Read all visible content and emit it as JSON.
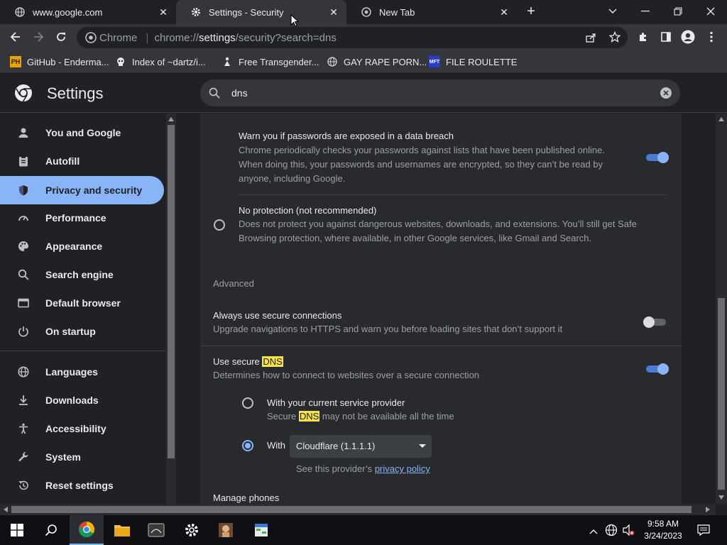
{
  "browser": {
    "tabs": [
      {
        "title": "www.google.com",
        "active": false,
        "icon": "globe-icon"
      },
      {
        "title": "Settings - Security",
        "active": true,
        "icon": "gear-icon"
      },
      {
        "title": "New Tab",
        "active": false,
        "icon": "chrome-icon"
      }
    ],
    "omnibox": {
      "site_chip": "Chrome",
      "url_prefix": "chrome://",
      "url_host": "settings",
      "url_rest": "/security?search=dns"
    },
    "bookmarks": [
      {
        "label": "GitHub - Enderma...",
        "icon": "PH"
      },
      {
        "label": "Index of ~dartz/i...",
        "icon": "skull-icon"
      },
      {
        "label": "Free Transgender...",
        "icon": "figure-icon"
      },
      {
        "label": "GAY RAPE PORN...",
        "icon": "globe-icon"
      },
      {
        "label": "FILE ROULETTE",
        "icon": "MFT"
      }
    ]
  },
  "settings": {
    "title": "Settings",
    "search_value": "dns",
    "nav": [
      {
        "label": "You and Google",
        "icon": "person-icon",
        "selected": false
      },
      {
        "label": "Autofill",
        "icon": "clipboard-icon",
        "selected": false
      },
      {
        "label": "Privacy and security",
        "icon": "shield-icon",
        "selected": true
      },
      {
        "label": "Performance",
        "icon": "speedometer-icon",
        "selected": false
      },
      {
        "label": "Appearance",
        "icon": "palette-icon",
        "selected": false
      },
      {
        "label": "Search engine",
        "icon": "search-icon",
        "selected": false
      },
      {
        "label": "Default browser",
        "icon": "browser-icon",
        "selected": false
      },
      {
        "label": "On startup",
        "icon": "power-icon",
        "selected": false
      },
      {
        "label": "Languages",
        "icon": "globe-icon",
        "selected": false
      },
      {
        "label": "Downloads",
        "icon": "download-icon",
        "selected": false
      },
      {
        "label": "Accessibility",
        "icon": "accessibility-icon",
        "selected": false
      },
      {
        "label": "System",
        "icon": "wrench-icon",
        "selected": false
      },
      {
        "label": "Reset settings",
        "icon": "reset-icon",
        "selected": false
      }
    ],
    "content": {
      "breach_title": "Warn you if passwords are exposed in a data breach",
      "breach_desc_1": "Chrome periodically checks your passwords against lists that have been published online.",
      "breach_desc_2": "When doing this, your passwords and usernames are encrypted, so they can’t be read by",
      "breach_desc_3": "anyone, including Google.",
      "breach_enabled": true,
      "no_protection_title": "No protection (not recommended)",
      "no_protection_desc_1": "Does not protect you against dangerous websites, downloads, and extensions. You’ll still get Safe",
      "no_protection_desc_2": "Browsing protection, where available, in other Google services, like Gmail and Search.",
      "advanced_heading": "Advanced",
      "https_title": "Always use secure connections",
      "https_desc": "Upgrade navigations to HTTPS and warn you before loading sites that don’t support it",
      "https_enabled": false,
      "dns_title_pre": "Use secure ",
      "dns_title_hl": "DNS",
      "dns_desc": "Determines how to connect to websites over a secure connection",
      "dns_enabled": true,
      "provider_option_title": "With your current service provider",
      "provider_option_desc_pre": "Secure ",
      "provider_option_desc_hl": "DNS",
      "provider_option_desc_post": " may not be available all the time",
      "custom_option_label": "With",
      "custom_option_value": "Cloudflare (1.1.1.1)",
      "provider_policy_pre": "See this provider’s ",
      "provider_policy_link": "privacy policy",
      "manage_phones": "Manage phones"
    }
  },
  "taskbar": {
    "time": "9:58 AM",
    "date": "3/24/2023",
    "apps": [
      "start-icon",
      "search-icon",
      "chrome-icon",
      "file-explorer-icon",
      "terminal-icon",
      "settings-icon",
      "game-icon",
      "spreadsheet-icon"
    ]
  }
}
